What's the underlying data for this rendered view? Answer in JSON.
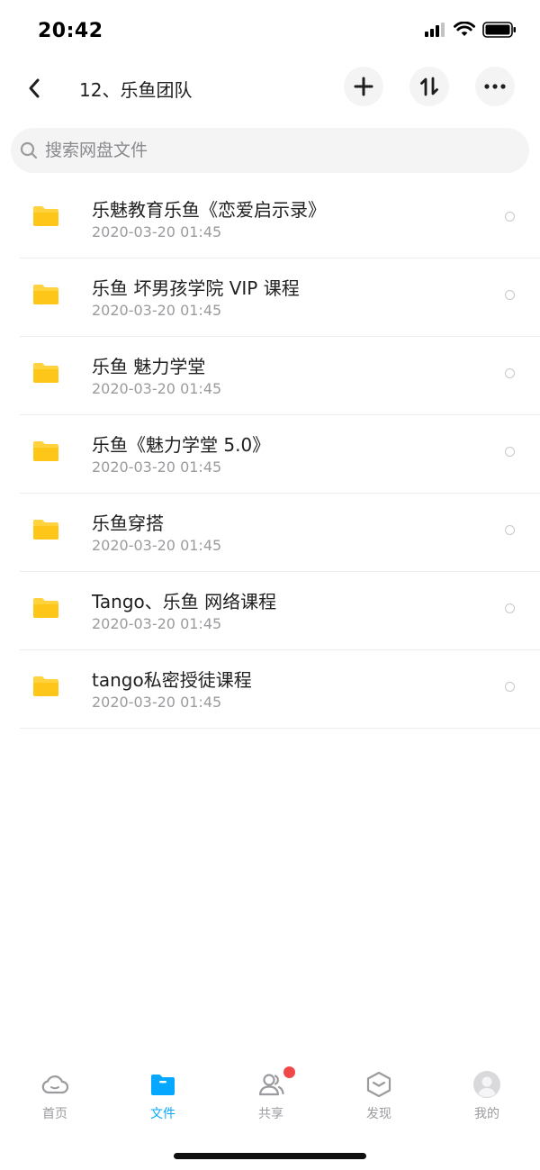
{
  "status_bar": {
    "time": "20:42"
  },
  "header": {
    "back_icon": "chevron-left-icon",
    "title": "12、乐鱼团队",
    "actions": [
      {
        "name": "add-button",
        "icon": "plus-icon"
      },
      {
        "name": "sort-button",
        "icon": "sort-arrows-icon"
      },
      {
        "name": "more-button",
        "icon": "ellipsis-icon"
      }
    ]
  },
  "search": {
    "placeholder": "搜索网盘文件",
    "value": ""
  },
  "files": [
    {
      "name": "乐魅教育乐鱼《恋爱启示录》",
      "date": "2020-03-20 01:45",
      "icon": "folder-icon"
    },
    {
      "name": "乐鱼 坏男孩学院 VIP 课程",
      "date": "2020-03-20 01:45",
      "icon": "folder-icon"
    },
    {
      "name": "乐鱼 魅力学堂",
      "date": "2020-03-20 01:45",
      "icon": "folder-icon"
    },
    {
      "name": "乐鱼《魅力学堂 5.0》",
      "date": "2020-03-20 01:45",
      "icon": "folder-icon"
    },
    {
      "name": "乐鱼穿搭",
      "date": "2020-03-20 01:45",
      "icon": "folder-icon"
    },
    {
      "name": "Tango、乐鱼 网络课程",
      "date": "2020-03-20 01:45",
      "icon": "folder-icon"
    },
    {
      "name": "tango私密授徒课程",
      "date": "2020-03-20 01:45",
      "icon": "folder-icon"
    }
  ],
  "tabs": [
    {
      "label": "首页",
      "icon": "cloud-icon",
      "active": false
    },
    {
      "label": "文件",
      "icon": "folder-tab-icon",
      "active": true
    },
    {
      "label": "共享",
      "icon": "people-icon",
      "active": false,
      "badge": true
    },
    {
      "label": "发现",
      "icon": "cube-icon",
      "active": false
    },
    {
      "label": "我的",
      "icon": "avatar-icon",
      "active": false
    }
  ],
  "colors": {
    "accent": "#06a7ff",
    "folder": "#ffd23e",
    "badge": "#f04848",
    "muted_text": "#9b9b9f"
  }
}
